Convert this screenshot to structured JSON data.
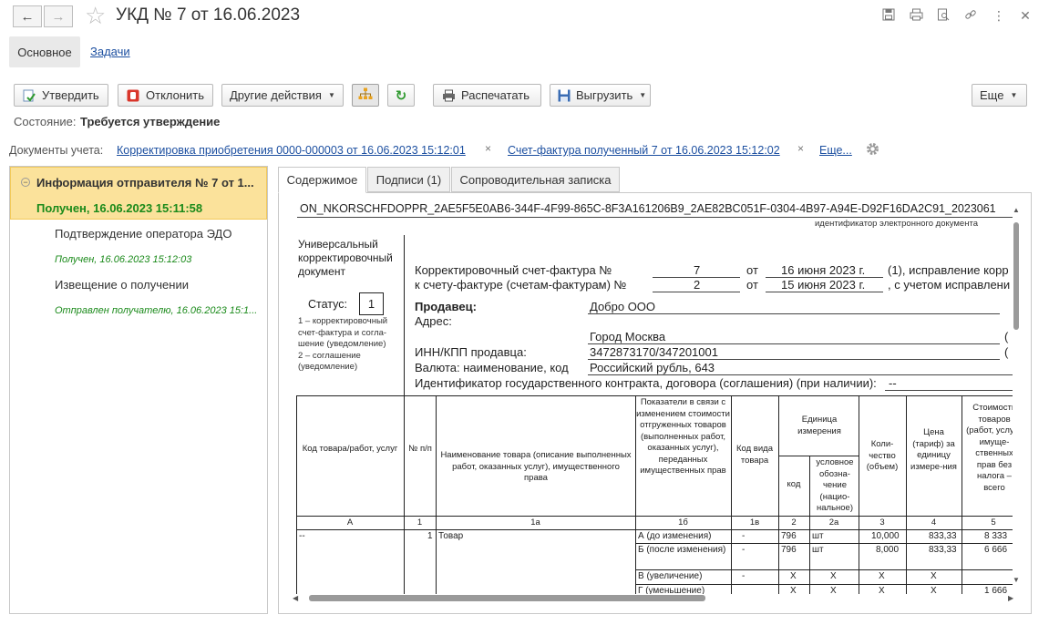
{
  "window": {
    "title": "УКД № 7 от 16.06.2023",
    "back_icon": "←",
    "forward_icon": "→"
  },
  "section_tabs": [
    "Основное",
    "Задачи"
  ],
  "toolbar": {
    "approve": "Утвердить",
    "reject": "Отклонить",
    "other_actions": "Другие действия",
    "print": "Распечатать",
    "export": "Выгрузить",
    "more": "Еще"
  },
  "state": {
    "label": "Состояние:",
    "value": "Требуется утверждение"
  },
  "accounting_docs": {
    "label": "Документы учета:",
    "links": [
      "Корректировка приобретения 0000-000003 от 16.06.2023 15:12:01",
      "Счет-фактура полученный 7 от 16.06.2023 15:12:02"
    ],
    "more": "Еще..."
  },
  "tree": {
    "selected_title": "Информация отправителя № 7 от 1...",
    "selected_status": "Получен, 16.06.2023 15:11:58",
    "items": [
      {
        "title": "Подтверждение оператора ЭДО",
        "status": "Получен, 16.06.2023 15:12:03"
      },
      {
        "title": "Извещение о получении",
        "status": "Отправлен получателю, 16.06.2023 15:1..."
      }
    ]
  },
  "content_tabs": [
    "Содержимое",
    "Подписи (1)",
    "Сопроводительная записка"
  ],
  "document": {
    "file_id": "ON_NKORSCHFDOPPR_2AE5F5E0AB6-344F-4F99-865C-8F3A161206B9_2AE82BC051F-0304-4B97-A94E-D92F16DA2C91_2023061",
    "file_id_caption": "идентификатор электронного документа",
    "ucd_title": [
      "Универсальный",
      "корректировочный",
      "документ"
    ],
    "status_label": "Статус:",
    "status_value": "1",
    "status_notes": [
      "1 – корректировочный",
      "счет-фактура и согла-",
      "шение (уведомление)",
      "2 – соглашение",
      "(уведомление)"
    ],
    "invoice_label": "Корректировочный счет-фактура №",
    "invoice_number": "7",
    "from_1": "от",
    "invoice_date": "16 июня 2023 г.",
    "invoice_tail": "(1),  исправление корр",
    "base_label": "к счету-фактуре (счетам-фактурам) №",
    "base_number": "2",
    "from_2": "от",
    "base_date": "15 июня 2023 г.",
    "base_tail": ", с учетом исправлени",
    "seller_label": "Продавец:",
    "seller_value": "Добро ООО",
    "address_label": "Адрес:",
    "address_value": "Город Москва",
    "inn_label": "ИНН/КПП продавца:",
    "inn_value": "3472873170/347201001",
    "currency_label": "Валюта: наименование, код",
    "currency_value": "Российский рубль, 643",
    "contract_label": "Идентификатор государственного контракта, договора (соглашения) (при наличии):",
    "contract_value": "--",
    "paren_1": "(",
    "paren_2": "(",
    "paren_3": "(",
    "table": {
      "headers": {
        "code": "Код товара/работ, услуг",
        "num": "№ п/п",
        "name": "Наименование товара (описание выполненных работ, оказанных услуг), имущественного права",
        "indicators": "Показатели в связи с изменением стоимости отгруженных товаров (выполненных работ, оказанных услуг), переданных имущественных прав",
        "kind": "Код вида товара",
        "unit": "Единица измерения",
        "unit_code": "код",
        "unit_sym": "условное обозна-чение (нацио-нальное)",
        "qty": "Коли-чество (объем)",
        "price": "Цена (тариф) за единицу измере-ния",
        "cost": "Стоимость товаров (работ, услуг), имуще-ственных прав без налога – всего"
      },
      "col_numbers": [
        "А",
        "1",
        "1а",
        "1б",
        "1в",
        "2",
        "2а",
        "3",
        "4",
        "5"
      ],
      "row": {
        "code": "--",
        "num": "1",
        "name": "Товар",
        "lines": [
          {
            "indicator": "А (до изменения)",
            "kind": "-",
            "unit_code": "796",
            "unit_sym": "шт",
            "qty": "10,000",
            "price": "833,33",
            "cost": "8 333"
          },
          {
            "indicator": "Б (после изменения)",
            "kind": "-",
            "unit_code": "796",
            "unit_sym": "шт",
            "qty": "8,000",
            "price": "833,33",
            "cost": "6 666"
          },
          {
            "indicator": "В (увеличение)",
            "kind": "-",
            "unit_code": "X",
            "unit_sym": "X",
            "qty": "X",
            "price": "X",
            "cost": ""
          },
          {
            "indicator": "Г (уменьшение)",
            "kind": "",
            "unit_code": "X",
            "unit_sym": "X",
            "qty": "X",
            "price": "X",
            "cost": "1 666"
          }
        ]
      }
    }
  }
}
